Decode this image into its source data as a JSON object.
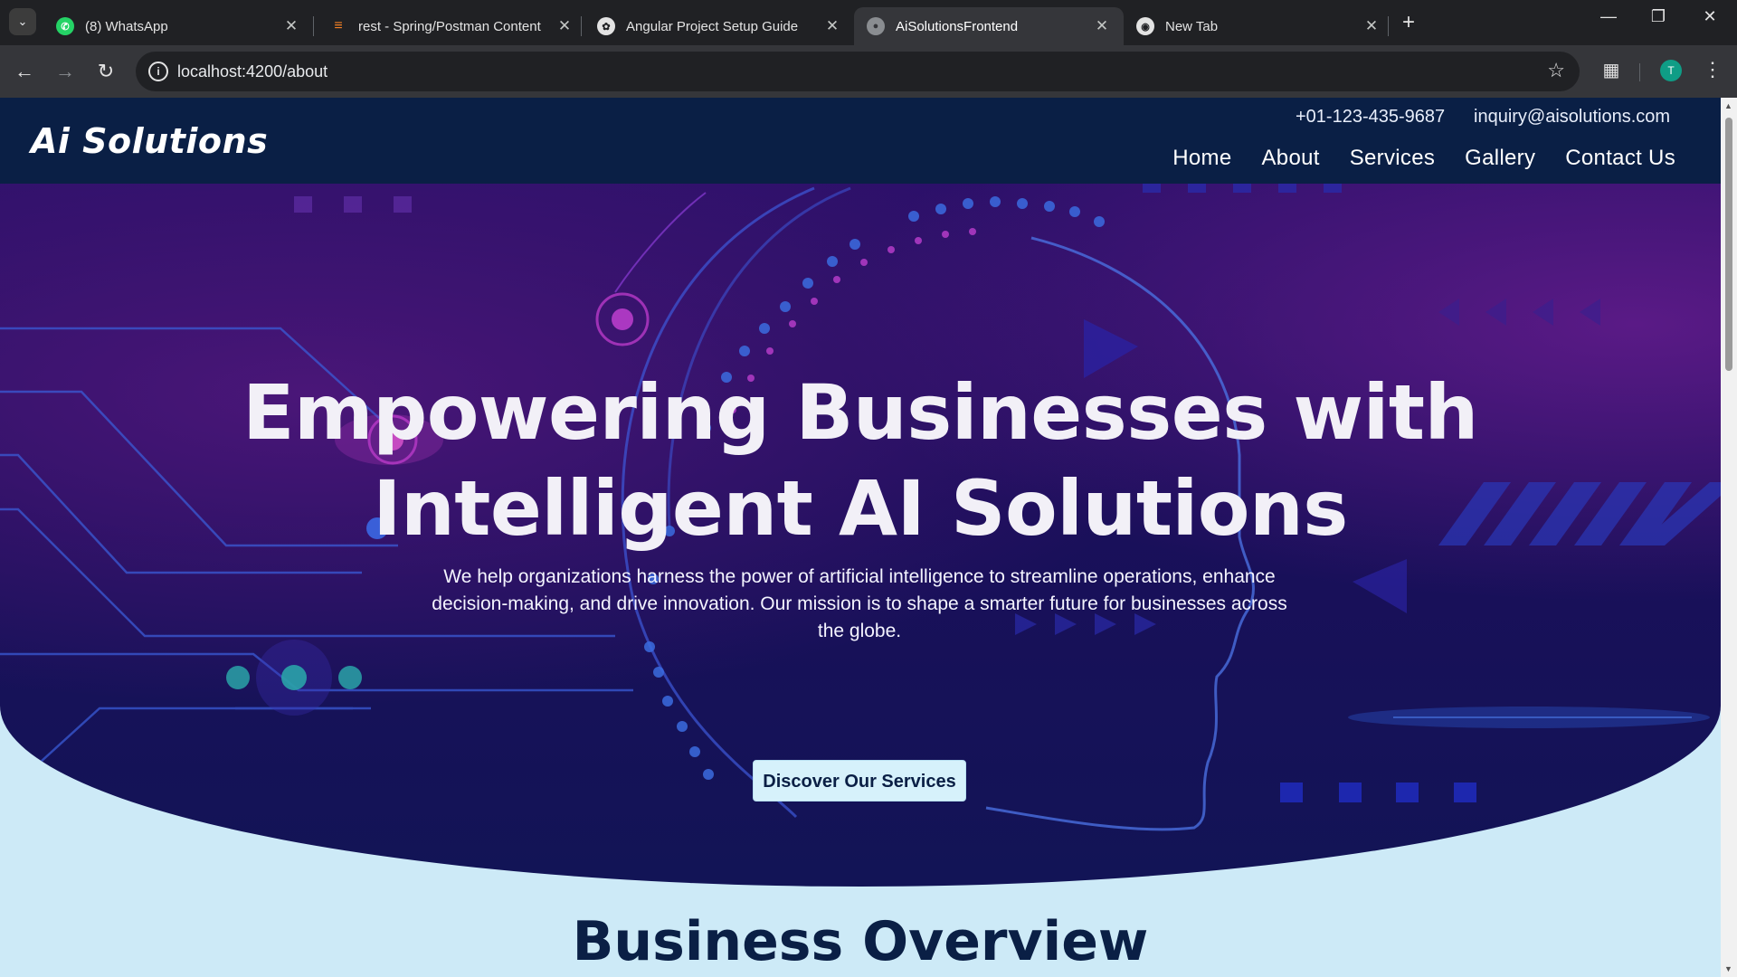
{
  "browser": {
    "tabs": [
      {
        "title": "(8) WhatsApp",
        "icon": "whatsapp-icon",
        "active": false
      },
      {
        "title": "rest - Spring/Postman Content",
        "icon": "stackoverflow-icon",
        "active": false
      },
      {
        "title": "Angular Project Setup Guide",
        "icon": "chatgpt-icon",
        "active": false
      },
      {
        "title": "AiSolutionsFrontend",
        "icon": "globe-icon",
        "active": true
      },
      {
        "title": "New Tab",
        "icon": "chrome-icon",
        "active": false
      }
    ],
    "url": "localhost:4200/about",
    "profile_initial": "T"
  },
  "site": {
    "logo": "Ai Solutions",
    "phone": "+01-123-435-9687",
    "email": "inquiry@aisolutions.com",
    "nav": [
      "Home",
      "About",
      "Services",
      "Gallery",
      "Contact Us"
    ]
  },
  "hero": {
    "title_line1": "Empowering Businesses with",
    "title_line2": "Intelligent AI Solutions",
    "text": "We help organizations harness the power of artificial intelligence to streamline operations, enhance decision-making, and drive innovation. Our mission is to shape a smarter future for businesses across the globe.",
    "button": "Discover Our Services"
  },
  "overview": {
    "title": "Business Overview"
  },
  "colors": {
    "header_bg": "#0a1f45",
    "hero_purple": "#2b1069",
    "page_bg": "#cdeaf7",
    "button_bg": "#d6f1fb"
  }
}
